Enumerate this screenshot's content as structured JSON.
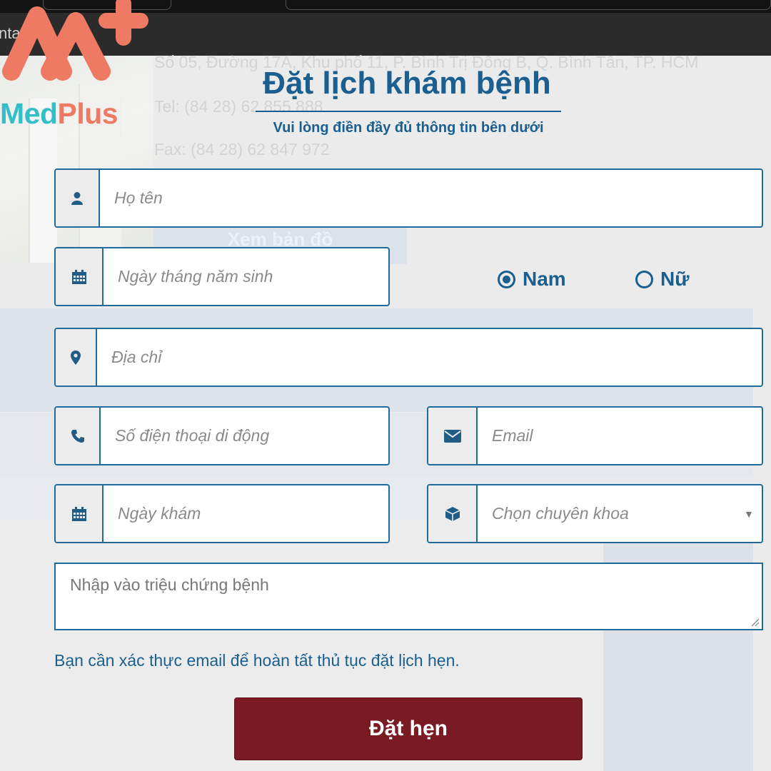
{
  "topbar": {
    "text": "nta"
  },
  "background": {
    "address": "Số 05, Đường 17A, Khu phố 11, P. Bình Trị Đông B, Q. Bình Tân, TP. HCM",
    "tel": "Tel: (84 28) 62 855 888",
    "fax": "Fax: (84 28) 62 847 972",
    "map_button": "Xem bản đồ"
  },
  "logo": {
    "text_med": "Med",
    "text_plus": "Plus"
  },
  "form": {
    "title": "Đặt lịch khám bệnh",
    "subtitle": "Vui lòng điền đầy đủ thông tin bên dưới",
    "name_placeholder": "Họ tên",
    "dob_placeholder": "Ngày tháng năm sinh",
    "gender": {
      "male_label": "Nam",
      "female_label": "Nữ",
      "selected": "Nam"
    },
    "address_placeholder": "Địa chỉ",
    "phone_placeholder": "Số điện thoại di động",
    "email_placeholder": "Email",
    "visit_date_placeholder": "Ngày khám",
    "specialty_placeholder": "Chọn chuyên khoa",
    "symptoms_placeholder": "Nhập vào triệu chứng bệnh",
    "note": "Bạn cần xác thực email để hoàn tất thủ tục đặt lịch hẹn.",
    "submit_label": "Đặt hẹn"
  },
  "colors": {
    "primary": "#1a5f8f",
    "field_border": "#1f6b9c",
    "submit_bg": "#7a1a22",
    "logo_coral": "#ef7a64",
    "logo_teal": "#34bfc8"
  },
  "icons": [
    "user-icon",
    "calendar-icon",
    "map-marker-icon",
    "phone-icon",
    "envelope-icon",
    "cube-icon",
    "caret-down-icon"
  ]
}
